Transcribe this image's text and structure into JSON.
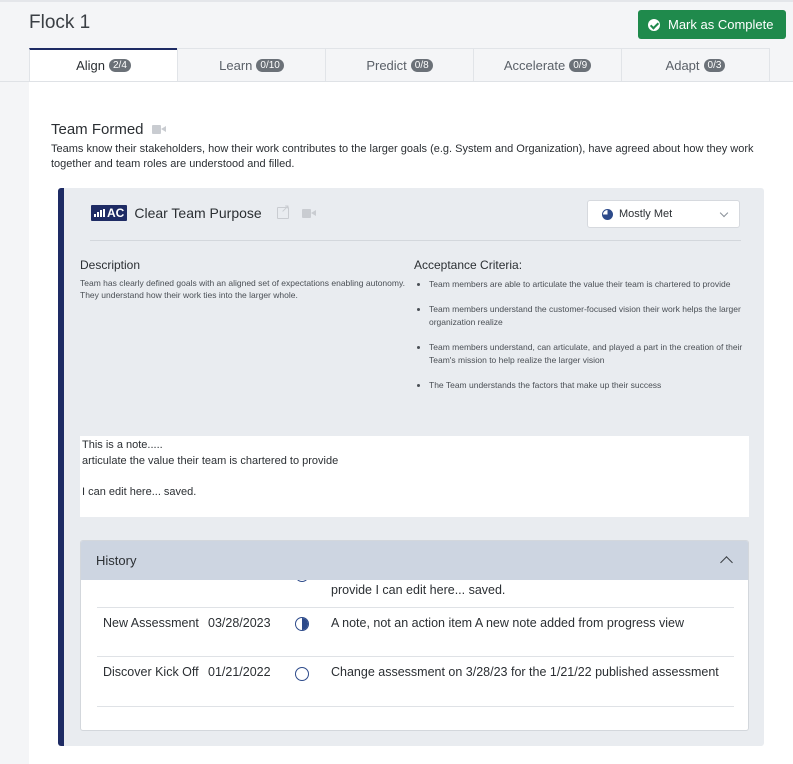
{
  "header": {
    "title": "Flock 1",
    "complete_button": "Mark as Complete"
  },
  "tabs": [
    {
      "label": "Align",
      "badge": "2/4"
    },
    {
      "label": "Learn",
      "badge": "0/10"
    },
    {
      "label": "Predict",
      "badge": "0/8"
    },
    {
      "label": "Accelerate",
      "badge": "0/9"
    },
    {
      "label": "Adapt",
      "badge": "0/3"
    }
  ],
  "section": {
    "title": "Team Formed",
    "description": "Teams know their stakeholders, how their work contributes to the larger goals (e.g. System and Organization), have agreed about how they work together and team roles are understood and filled."
  },
  "card": {
    "logo_text": "AC",
    "title": "Clear Team Purpose",
    "status": "Mostly Met",
    "description_heading": "Description",
    "description": "Team has clearly defined goals with an aligned set of expectations enabling autonomy. They understand how their work ties into the larger whole.",
    "acceptance_heading": "Acceptance Criteria:",
    "acceptance_criteria": [
      "Team members are able to articulate the value their team is chartered to provide",
      "Team members understand the customer-focused vision their work helps the larger organization realize",
      "Team members understand, can articulate, and played a part in the creation of their Team's mission to help realize the larger vision",
      "The Team understands the factors that make up their success"
    ],
    "note": "This is a note.....\narticulate the value their team is chartered to provide\n\nI can edit here... saved."
  },
  "history": {
    "title": "History",
    "rows": [
      {
        "name": "",
        "date": "",
        "note": "provide I can edit here... saved.",
        "icon": "pie-three-quarter-icon"
      },
      {
        "name": "New Assessment",
        "date": "03/28/2023",
        "note": "A note, not an action item A new note added from progress view",
        "icon": "pie-half-icon"
      },
      {
        "name": "Discover Kick Off",
        "date": "01/21/2022",
        "note": "Change assessment on 3/28/23 for the 1/21/22 published assessment",
        "icon": "pie-three-quarter-icon"
      }
    ]
  },
  "colors": {
    "brand_navy": "#1e2b64",
    "complete_green": "#1f8a4c",
    "history_header": "#cdd5e1"
  }
}
